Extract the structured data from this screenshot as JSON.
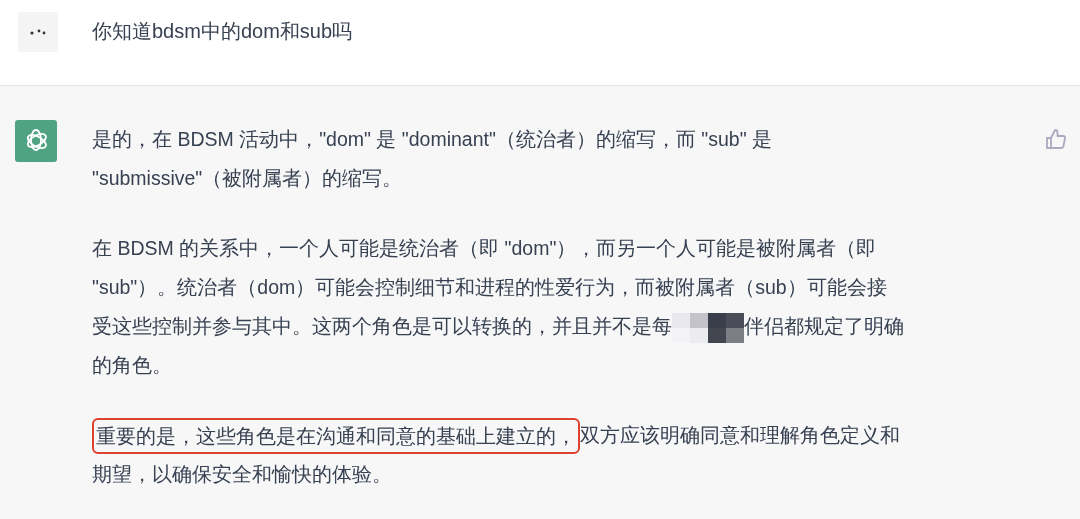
{
  "question": {
    "text": "你知道bdsm中的dom和sub吗"
  },
  "answer": {
    "paragraphs": [
      [
        [
          {
            "kind": "text",
            "text": "是的，在 BDSM 活动中，\"dom\" 是 \"dominant\"（统治者）的缩写，而 \"sub\" 是"
          }
        ],
        [
          {
            "kind": "text",
            "text": "\"submissive\"（被附属者）的缩写。"
          }
        ]
      ],
      [
        [
          {
            "kind": "text",
            "text": "在 BDSM 的关系中，一个人可能是统治者（即 \"dom\"），而另一个人可能是被附属者（即"
          }
        ],
        [
          {
            "kind": "text",
            "text": "\"sub\"）。统治者（dom）可能会控制细节和进程的性爱行为，而被附属者（sub）可能会接"
          }
        ],
        [
          {
            "kind": "text",
            "text": "受这些控制并参与其中。这两个角色是可以转换的，并且并不是每"
          },
          {
            "kind": "mosaic"
          },
          {
            "kind": "text",
            "text": "伴侣都规定了明确"
          }
        ],
        [
          {
            "kind": "text",
            "text": "的角色。"
          }
        ]
      ],
      [
        [
          {
            "kind": "highlight",
            "text": "重要的是，这些角色是在沟通和同意的基础上建立的，"
          },
          {
            "kind": "text",
            "text": "双方应该明确同意和理解角色定义和"
          }
        ],
        [
          {
            "kind": "text",
            "text": "期望，以确保安全和愉快的体验。"
          }
        ]
      ]
    ]
  }
}
